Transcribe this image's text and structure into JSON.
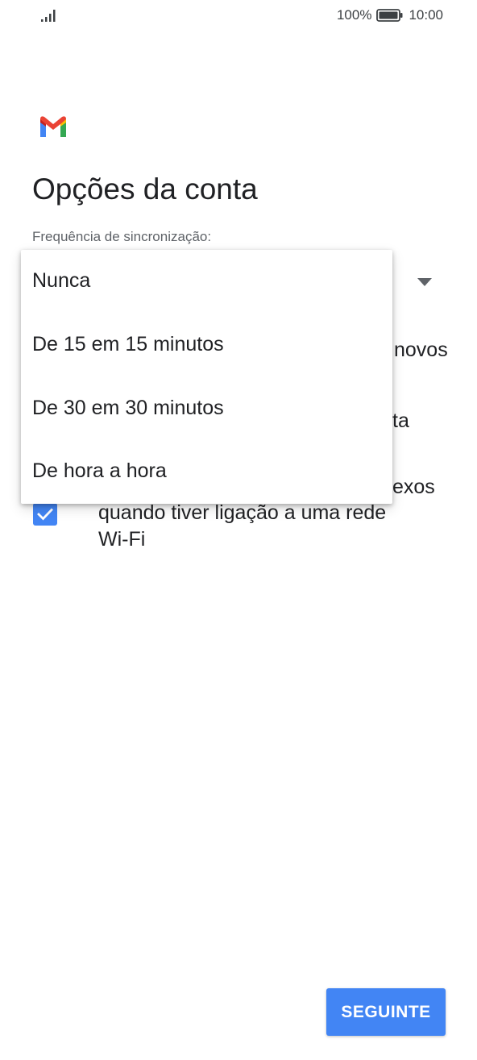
{
  "status_bar": {
    "battery_percent": "100%",
    "time": "10:00"
  },
  "header": {
    "logo": "gmail-logo-icon",
    "title": "Opções da conta"
  },
  "sync_frequency": {
    "label": "Frequência de sincronização:",
    "options": [
      "Nunca",
      "De 15 em 15 minutos",
      "De 30 em 30 minutos",
      "De hora a hora"
    ]
  },
  "background_options": {
    "option1_visible_fragment": "novos",
    "option2_visible_fragment": "ta",
    "option3_visible_fragment": "exos",
    "option3_line2": "quando tiver ligação a uma rede",
    "option3_line3": "Wi-Fi",
    "option3_checked": true
  },
  "footer": {
    "next_label": "SEGUINTE"
  },
  "colors": {
    "accent": "#4285f4",
    "text_primary": "#202124",
    "text_secondary": "#5f6368"
  }
}
